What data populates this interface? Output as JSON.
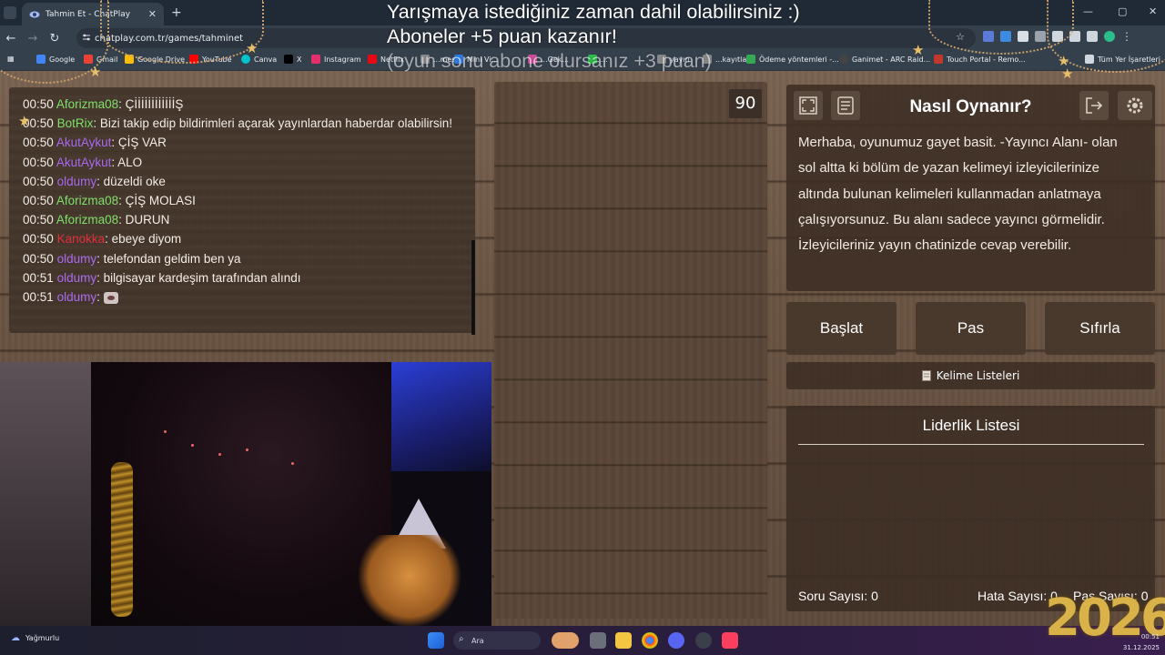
{
  "browser": {
    "tab_title": "Tahmin Et - ChatPlay",
    "url": "chatplay.com.tr/games/tahminet",
    "bookmarks": [
      {
        "label": "Google",
        "color": "#4285f4"
      },
      {
        "label": "Gmail",
        "color": "#ea4335"
      },
      {
        "label": "Google Drive",
        "color": "#fbbc04"
      },
      {
        "label": "YouTube",
        "color": "#ff0000"
      },
      {
        "label": "Canva",
        "color": "#00c4cc"
      },
      {
        "label": "X",
        "color": "#000000"
      },
      {
        "label": "Instagram",
        "color": "#e1306c"
      },
      {
        "label": "Netflix",
        "color": "#e50914"
      },
      {
        "label": "...mess",
        "color": "#8a8a8a"
      },
      {
        "label": "Mini Vi...",
        "color": "#2d7be5"
      },
      {
        "label": "...Gek...",
        "color": "#c94d9b"
      },
      {
        "label": "...",
        "color": "#2bbd4a"
      },
      {
        "label": "yayın",
        "color": "#888888"
      },
      {
        "label": "...kayıtlar",
        "color": "#888888"
      },
      {
        "label": "Ödeme yöntemleri -...",
        "color": "#34a853"
      },
      {
        "label": "Ganimet - ARC Raid...",
        "color": "#444444"
      },
      {
        "label": "Touch Portal - Remo...",
        "color": "#c0392b"
      }
    ],
    "all_bookmarks_label": "Tüm Yer İşaretleri"
  },
  "overlay": {
    "line1": "Yarışmaya istediğiniz zaman dahil olabilirsiniz :)",
    "line2": "Aboneler +5 puan kazanır!",
    "line3": "(oyun sonu abone olursanız +3 puan)",
    "year": "2026"
  },
  "chat": {
    "messages": [
      {
        "time": "00:50",
        "user": "Aforizma08",
        "color": "#7ee06a",
        "text": ": ÇİİİİİİİİİİİİŞ"
      },
      {
        "time": "00:50",
        "user": "BotRix",
        "color": "#7ee06a",
        "text": ": Bizi takip edip bildirimleri açarak yayınlardan haberdar olabilirsin!"
      },
      {
        "time": "00:50",
        "user": "AkutAykut",
        "color": "#a96af0",
        "text": ": ÇİŞ VAR"
      },
      {
        "time": "00:50",
        "user": "AkutAykut",
        "color": "#a96af0",
        "text": ": ALO"
      },
      {
        "time": "00:50",
        "user": "oldumy",
        "color": "#a96af0",
        "text": ": düzeldi oke"
      },
      {
        "time": "00:50",
        "user": "Aforizma08",
        "color": "#7ee06a",
        "text": ": ÇİŞ MOLASI"
      },
      {
        "time": "00:50",
        "user": "Aforizma08",
        "color": "#7ee06a",
        "text": ": DURUN"
      },
      {
        "time": "00:50",
        "user": "Kanokka",
        "color": "#e0303a",
        "text": ": ebeye diyom"
      },
      {
        "time": "00:50",
        "user": "oldumy",
        "color": "#a96af0",
        "text": ": telefondan geldim ben ya"
      },
      {
        "time": "00:51",
        "user": "oldumy",
        "color": "#a96af0",
        "text": ": bilgisayar kardeşim tarafından alındı"
      },
      {
        "time": "00:51",
        "user": "oldumy",
        "color": "#a96af0",
        "text": ": "
      }
    ]
  },
  "game": {
    "timer": "90",
    "howto_title": "Nasıl Oynanır?",
    "howto_text": "Merhaba, oyunumuz gayet basit. -Yayıncı Alanı- olan sol altta ki bölüm de yazan kelimeyi izleyicilerinize altında bulunan kelimeleri kullanmadan anlatmaya çalışıyorsunuz. Bu alanı sadece yayıncı görmelidir. İzleyicileriniz yayın chatinizde cevap verebilir.",
    "buttons": {
      "start": "Başlat",
      "pass": "Pas",
      "reset": "Sıfırla"
    },
    "word_lists_label": "Kelime Listeleri",
    "leaderboard_title": "Liderlik Listesi",
    "stats": {
      "question_label": "Soru Sayısı: 0",
      "error_label": "Hata Sayısı: 0",
      "pass_label": "Pas Sayısı: 0"
    }
  },
  "taskbar": {
    "weather": "Yağmurlu",
    "search_placeholder": "Ara",
    "date": "31.12.2025",
    "time": "00:51"
  }
}
